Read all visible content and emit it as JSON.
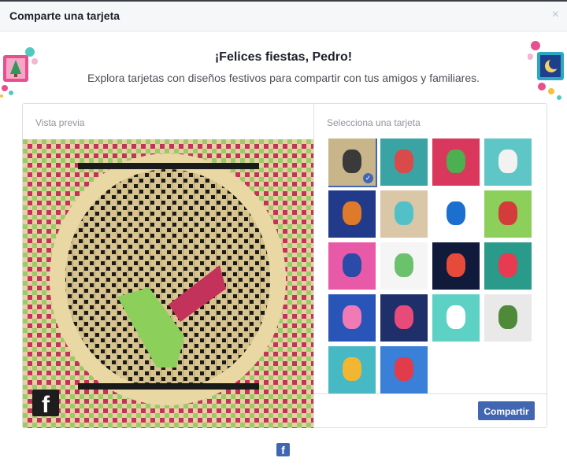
{
  "header": {
    "title": "Comparte una tarjeta",
    "close_symbol": "×"
  },
  "greeting": {
    "headline": "¡Felices fiestas, Pedro!",
    "subtitle": "Explora tarjetas con diseños festivos para compartir con tus amigos y familiares."
  },
  "preview": {
    "label": "Vista previa",
    "logo_letter": "f"
  },
  "selector": {
    "label": "Selecciona una tarjeta",
    "selected_index": 0,
    "cards": [
      {
        "name": "card-woven-pattern",
        "bg": "#c8b68a",
        "accent": "#3a3a3a"
      },
      {
        "name": "card-ornaments",
        "bg": "#3aa3a3",
        "accent": "#d94b4b"
      },
      {
        "name": "card-cactus-santa",
        "bg": "#d9385c",
        "accent": "#4caf50"
      },
      {
        "name": "card-snow-globe",
        "bg": "#5ec6c6",
        "accent": "#f2f2f2"
      },
      {
        "name": "card-forest-night",
        "bg": "#213b8a",
        "accent": "#e07a2b"
      },
      {
        "name": "card-sand-angel",
        "bg": "#d9c7a8",
        "accent": "#52c1c7"
      },
      {
        "name": "card-string-lights",
        "bg": "#ffffff",
        "accent": "#1a6fcf"
      },
      {
        "name": "card-bird",
        "bg": "#8ccf5b",
        "accent": "#d43b3b"
      },
      {
        "name": "card-moon-window",
        "bg": "#e85aa8",
        "accent": "#2c4aa8"
      },
      {
        "name": "card-snowman",
        "bg": "#f5f5f5",
        "accent": "#6cc16c"
      },
      {
        "name": "card-fireworks",
        "bg": "#101a3a",
        "accent": "#e64a3b"
      },
      {
        "name": "card-van",
        "bg": "#2a9a8a",
        "accent": "#e83a50"
      },
      {
        "name": "card-star-lanterns",
        "bg": "#2a55b8",
        "accent": "#f07ab6"
      },
      {
        "name": "card-gifts",
        "bg": "#1f2f6a",
        "accent": "#e84a7a"
      },
      {
        "name": "card-menorah-cup",
        "bg": "#5cd1c4",
        "accent": "#ffffff"
      },
      {
        "name": "card-leaf-angel",
        "bg": "#e9e9e9",
        "accent": "#4f8a3a"
      },
      {
        "name": "card-dreidel-coins",
        "bg": "#47b9c5",
        "accent": "#f2b632"
      },
      {
        "name": "card-wreath",
        "bg": "#3a7fd8",
        "accent": "#e23b4a"
      }
    ],
    "share_button": "Compartir"
  },
  "footer": {
    "logo_letter": "f"
  },
  "colors": {
    "brand": "#4267b2",
    "header_bg": "#f6f7f9",
    "border": "#dddfe2",
    "muted": "#90949c"
  }
}
